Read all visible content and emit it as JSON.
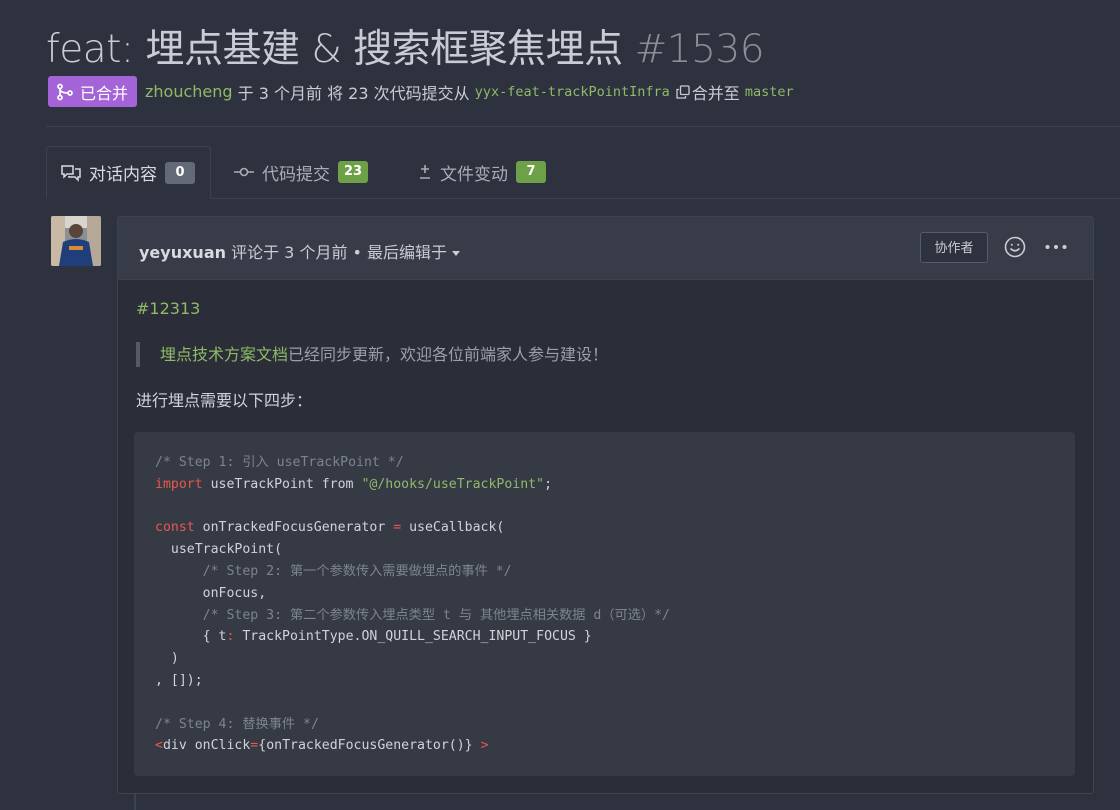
{
  "pr": {
    "title": "feat: 埋点基建 & 搜索框聚焦埋点",
    "number": "#1536",
    "status": "已合并",
    "author": "zhoucheng",
    "meta_text": " 于 3 个月前 将 23 次代码提交从 ",
    "source_branch": "yyx-feat-trackPointInfra",
    "merge_into": "合并至 ",
    "target_branch": "master"
  },
  "tabs": [
    {
      "label": "对话内容",
      "count": "0",
      "icon": "comments-icon"
    },
    {
      "label": "代码提交",
      "count": "23",
      "icon": "commit-icon"
    },
    {
      "label": "文件变动",
      "count": "7",
      "icon": "diff-icon"
    }
  ],
  "comment": {
    "author": "yeyuxuan",
    "meta": " 评论于 3 个月前 • 最后编辑于",
    "role": "协作者",
    "ref": "#12313",
    "quote_link": "埋点技术方案文档",
    "quote_rest": "已经同步更新，欢迎各位前端家人参与建设！",
    "paragraph": "进行埋点需要以下四步："
  },
  "code": {
    "lines": [
      "/* Step 1: 引入 useTrackPoint */",
      "import useTrackPoint from \"@/hooks/useTrackPoint\";",
      "",
      "const onTrackedFocusGenerator = useCallback(",
      "  useTrackPoint(",
      "      /* Step 2: 第一个参数传入需要做埋点的事件 */",
      "      onFocus,",
      "      /* Step 3: 第二个参数传入埋点类型 t 与 其他埋点相关数据 d（可选）*/",
      "      { t: TrackPointType.ON_QUILL_SEARCH_INPUT_FOCUS }",
      "  )",
      ", []);",
      "",
      "/* Step 4: 替换事件 */",
      "<div onClick={onTrackedFocusGenerator()} >"
    ]
  },
  "colors": {
    "background": "#2e323e",
    "merged": "#a463d6",
    "link": "#8fba68",
    "keyword": "#e8584a",
    "count_green": "#6ea047"
  }
}
